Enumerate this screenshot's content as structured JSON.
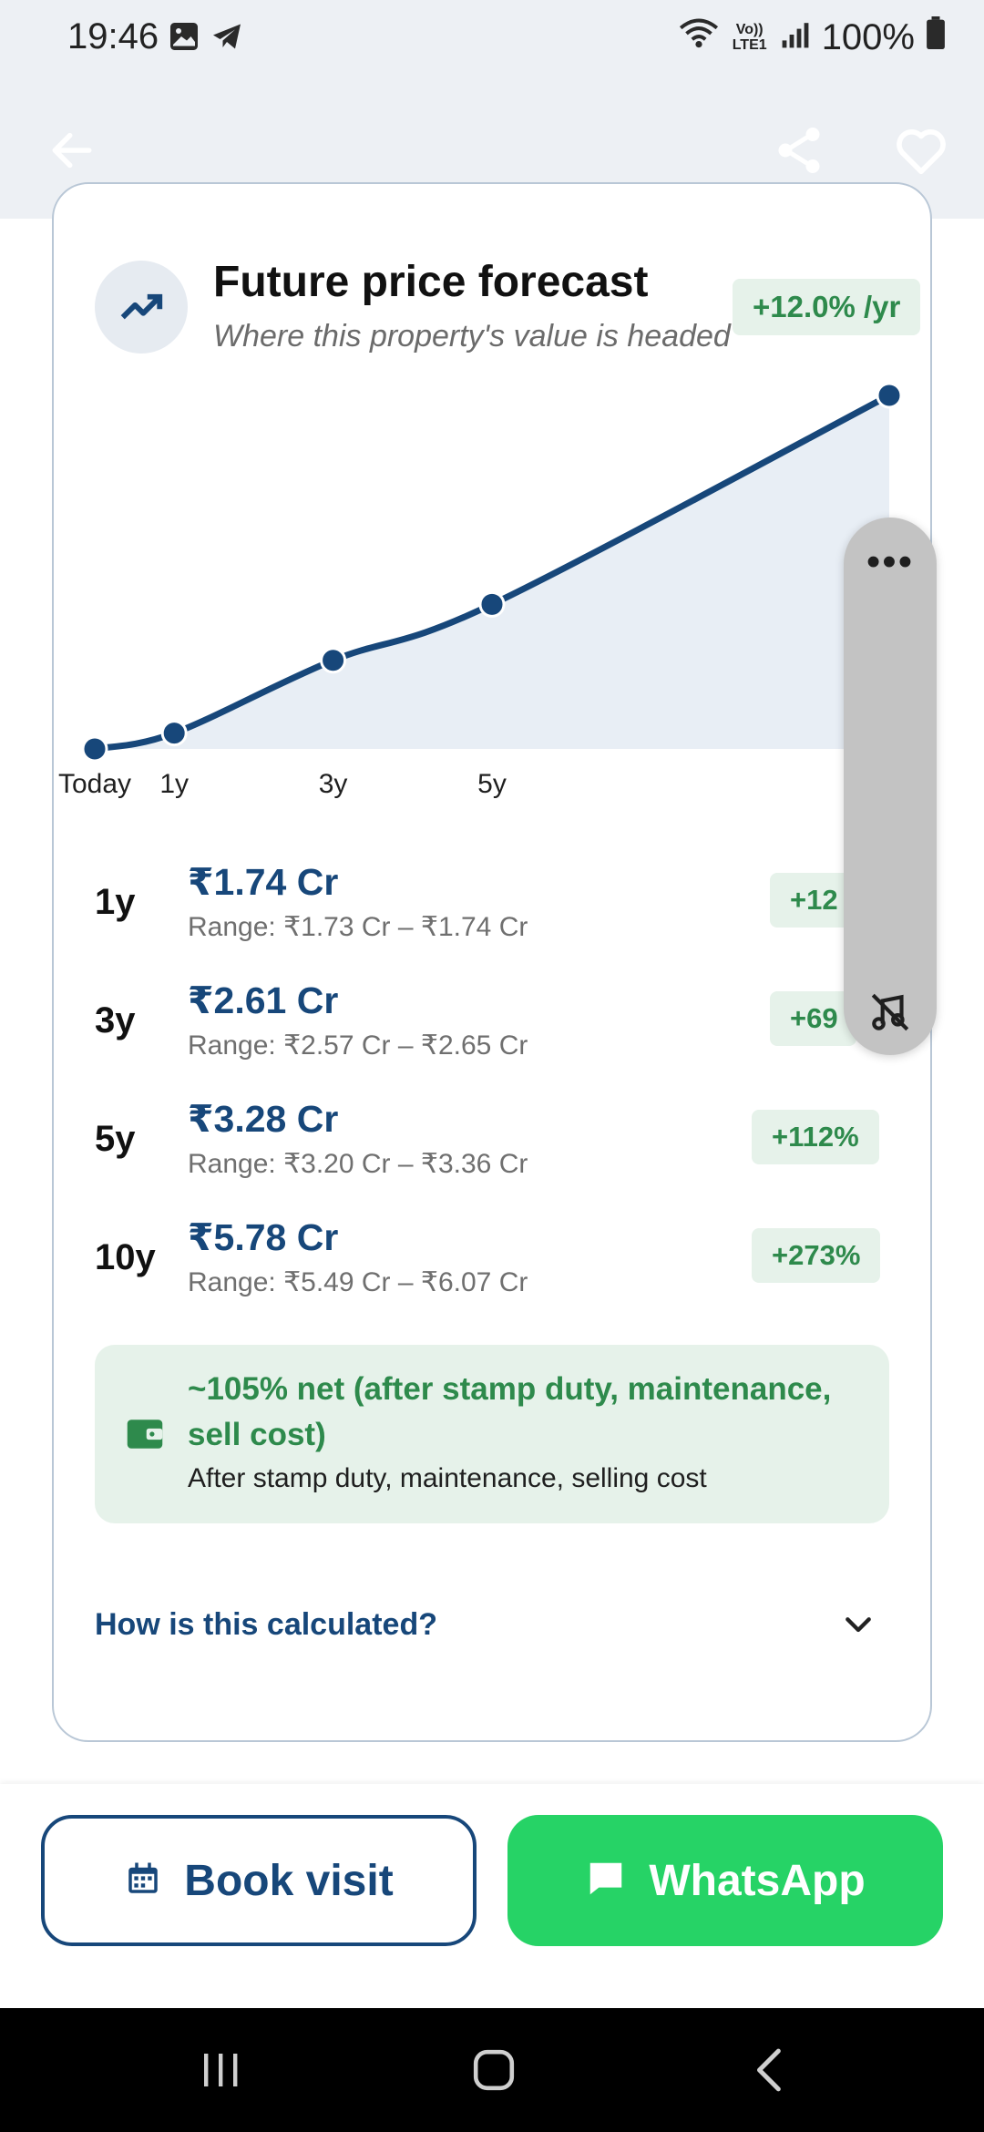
{
  "status_bar": {
    "time": "19:46",
    "battery": "100%",
    "network_label": "Vo)) LTE1",
    "icons": [
      "image-icon",
      "telegram-icon",
      "wifi-icon",
      "signal-icon",
      "battery-icon"
    ]
  },
  "app_bar": {
    "icons": [
      "back-arrow-icon",
      "share-icon",
      "heart-icon"
    ]
  },
  "forecast": {
    "title": "Future price forecast",
    "subtitle": "Where this property's value is headed",
    "rate_badge": "+12.0% /yr",
    "chart_data": {
      "type": "area",
      "categories": [
        "Today",
        "1y",
        "3y",
        "5y",
        "10y"
      ],
      "x_tick_labels": [
        "Today",
        "1y",
        "3y",
        "5y"
      ],
      "values": [
        1.55,
        1.74,
        2.61,
        3.28,
        5.78
      ],
      "unit": "Cr",
      "title": "",
      "xlabel": "",
      "ylabel": "",
      "ylim": [
        1.55,
        5.78
      ],
      "grid": false,
      "legend": "none",
      "line_color": "#17477a",
      "fill_color": "#e8eef5"
    },
    "rows": [
      {
        "label": "1y",
        "price": "₹1.74 Cr",
        "range": "Range: ₹1.73 Cr – ₹1.74 Cr",
        "change": "+12"
      },
      {
        "label": "3y",
        "price": "₹2.61 Cr",
        "range": "Range: ₹2.57 Cr – ₹2.65 Cr",
        "change": "+69"
      },
      {
        "label": "5y",
        "price": "₹3.28 Cr",
        "range": "Range: ₹3.20 Cr – ₹3.36 Cr",
        "change": "+112%"
      },
      {
        "label": "10y",
        "price": "₹5.78 Cr",
        "range": "Range: ₹5.49 Cr – ₹6.07 Cr",
        "change": "+273%"
      }
    ],
    "net": {
      "title": "~105% net (after stamp duty, maintenance, sell cost)",
      "subtitle": "After stamp duty, maintenance, selling cost"
    },
    "how_link": "How is this calculated?"
  },
  "floating_pill": {
    "menu": "•••"
  },
  "actions": {
    "book_visit": "Book visit",
    "whatsapp": "WhatsApp"
  },
  "colors": {
    "primary": "#17477a",
    "positive": "#2e8a4c",
    "positive_bg": "#e6f2ea",
    "whatsapp": "#26d366"
  }
}
